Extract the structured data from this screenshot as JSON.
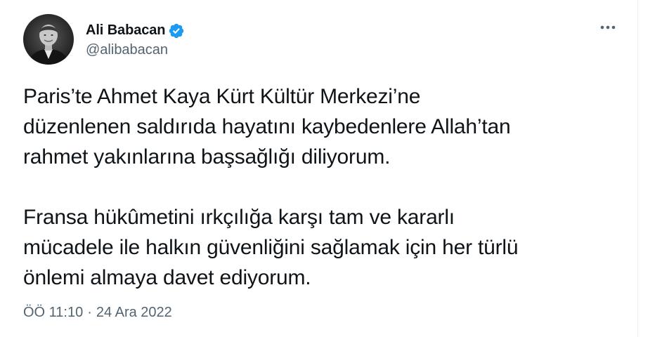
{
  "author": {
    "display_name": "Ali Babacan",
    "handle": "@alibabacan",
    "verified_icon": "verified-badge-icon",
    "avatar_icon": "profile-photo"
  },
  "actions": {
    "more_icon": "more-options-icon"
  },
  "tweet": {
    "paragraph_1": "Paris’te Ahmet Kaya Kürt Kültür Merkezi’ne\ndüzenlenen saldırıda hayatını kaybedenlere Allah’tan\nrahmet yakınlarına başsağlığı diliyorum.",
    "paragraph_2": "Fransa hükûmetini ırkçılığa karşı tam ve kararlı\nmücadele ile halkın güvenliğini sağlamak için her türlü\nönlemi almaya davet ediyorum."
  },
  "meta": {
    "time": "ÖÖ 11:10",
    "separator": "·",
    "date": "24 Ara 2022"
  },
  "colors": {
    "text": "#0f1419",
    "secondary": "#536471",
    "verified": "#1d9bf0"
  }
}
